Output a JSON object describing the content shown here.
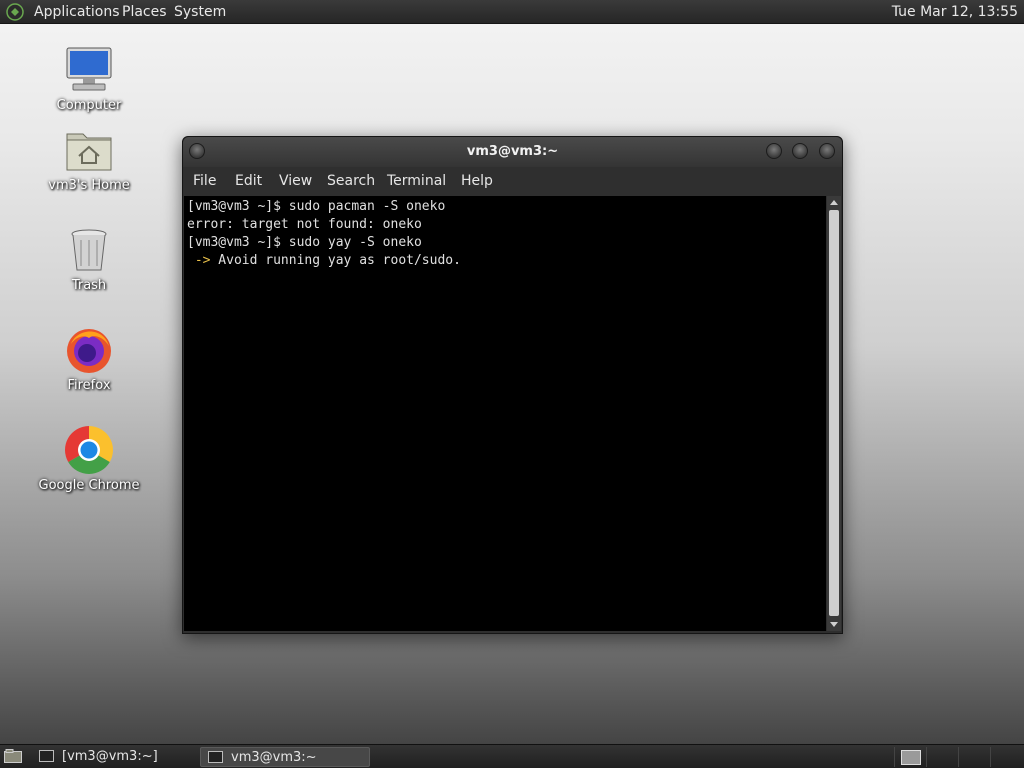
{
  "top_panel": {
    "menus": [
      "Applications",
      "Places",
      "System"
    ],
    "clock": "Tue Mar 12, 13:55"
  },
  "desktop_icons": [
    {
      "label": "Computer",
      "icon": "computer-icon"
    },
    {
      "label": "vm3's Home",
      "icon": "home-folder-icon"
    },
    {
      "label": "Trash",
      "icon": "trash-icon"
    },
    {
      "label": "Firefox",
      "icon": "firefox-icon"
    },
    {
      "label": "Google Chrome",
      "icon": "chrome-icon"
    }
  ],
  "terminal": {
    "title": "vm3@vm3:~",
    "menu": [
      "File",
      "Edit",
      "View",
      "Search",
      "Terminal",
      "Help"
    ],
    "lines": [
      "[vm3@vm3 ~]$ sudo pacman -S oneko",
      "error: target not found: oneko",
      "[vm3@vm3 ~]$ sudo yay -S oneko",
      " -> Avoid running yay as root/sudo."
    ]
  },
  "taskbar": {
    "tasks": [
      "[vm3@vm3:~]",
      "vm3@vm3:~"
    ],
    "active_task_index": 1
  },
  "colors": {
    "terminal_bg": "#000000",
    "terminal_fg": "#e0e0e0",
    "warning_arrow": "#e8c04a"
  }
}
